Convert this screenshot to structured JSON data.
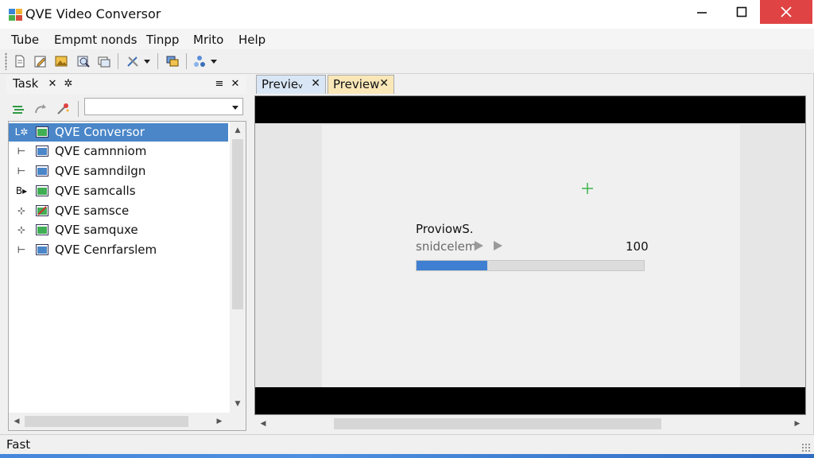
{
  "window": {
    "title": "QVE Video Conversor",
    "app_icon": "app-logo-icon",
    "controls": [
      "minimize-icon",
      "maximize-icon",
      "close-icon"
    ]
  },
  "menu": {
    "items": [
      "Tube",
      "Empmt nonds",
      "Tinpp",
      "Mrito",
      "Help"
    ]
  },
  "toolbar": {
    "icons": [
      "new-document-icon",
      "edit-icon",
      "image-icon",
      "preview-search-icon",
      "windows-icon",
      "tools-icon",
      "dropdown-arrow-icon",
      "layers-icon",
      "effects-icon",
      "dropdown-arrow-icon"
    ]
  },
  "task_panel": {
    "title": "Task",
    "header_icons": [
      "pin-icon",
      "float-icon",
      "menu-icon",
      "close-icon"
    ],
    "toolbar_icons": [
      "add-task-icon",
      "redo-icon",
      "magic-wand-icon"
    ],
    "select_value": "",
    "items": [
      {
        "label": "QVE Conversor",
        "selected": true,
        "expander": "L✲"
      },
      {
        "label": "QVE camnniom",
        "selected": false,
        "expander": "⊢"
      },
      {
        "label": "QVE samndilgn",
        "selected": false,
        "expander": "⊢"
      },
      {
        "label": "QVE samcalls",
        "selected": false,
        "expander": "B▸"
      },
      {
        "label": "QVE samsce",
        "selected": false,
        "expander": "⊹"
      },
      {
        "label": "QVE samquxe",
        "selected": false,
        "expander": "⊹"
      },
      {
        "label": "QVE Cenrfarslem",
        "selected": false,
        "expander": "⊢"
      }
    ]
  },
  "preview_panel": {
    "tabs": [
      {
        "label": "Previeᵥ",
        "active": false
      },
      {
        "label": "Preview",
        "active": true
      }
    ],
    "progress": {
      "title": "ProviowS.",
      "status": "snidcelem",
      "value_text": "100",
      "fraction": 0.31
    }
  },
  "status": {
    "text": "Fast"
  },
  "colors": {
    "selection": "#4a86c8",
    "progress_fill": "#3f7fd1",
    "active_tab": "#f9e7b8",
    "inactive_tab": "#d9e6f5",
    "close_button": "#e04343"
  }
}
